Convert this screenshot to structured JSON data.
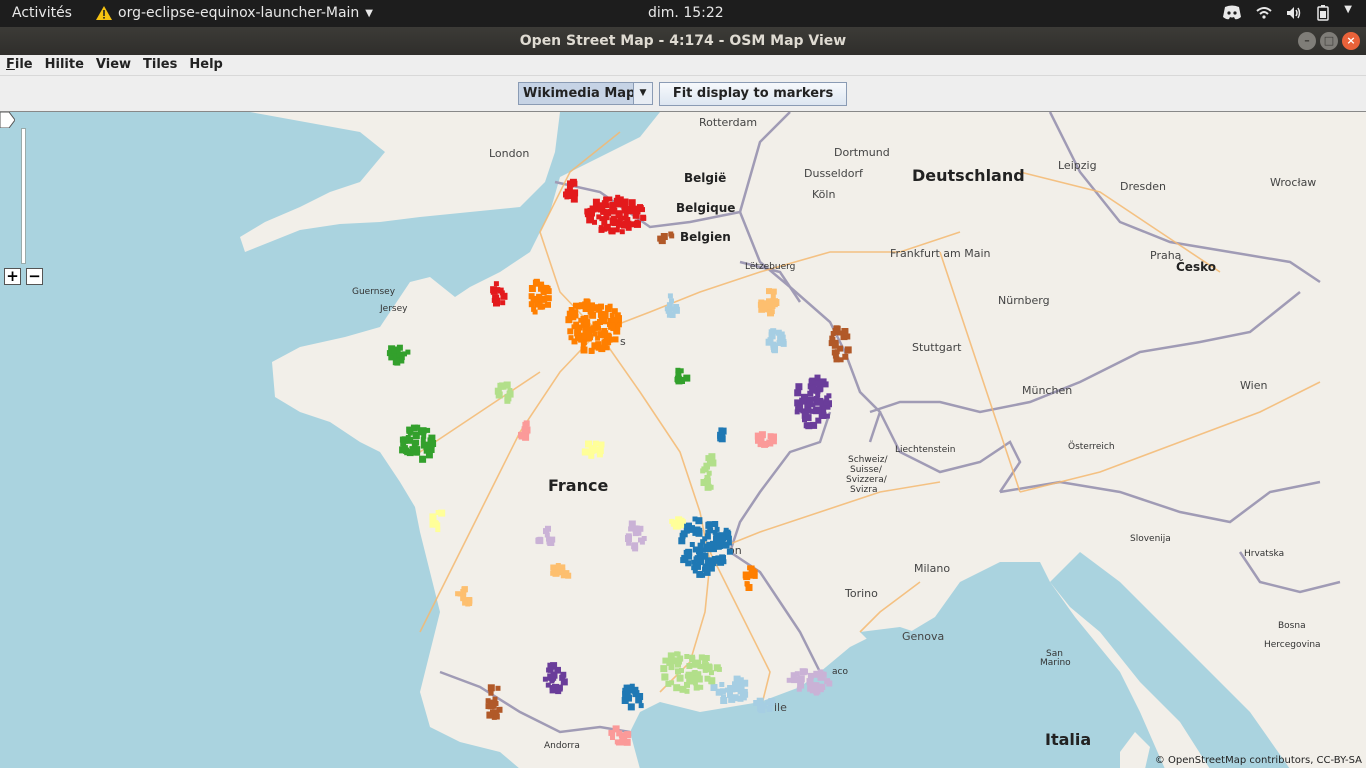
{
  "topbar": {
    "activities": "Activités",
    "app_name": "org-eclipse-equinox-launcher-Main",
    "clock": "dim. 15:22"
  },
  "window": {
    "title": "Open Street Map - 4:174 - OSM Map View"
  },
  "menubar": {
    "items": [
      {
        "label": "File",
        "mnemonic": "F"
      },
      {
        "label": "Hilite",
        "mnemonic": ""
      },
      {
        "label": "View",
        "mnemonic": ""
      },
      {
        "label": "Tiles",
        "mnemonic": ""
      },
      {
        "label": "Help",
        "mnemonic": ""
      }
    ]
  },
  "toolbar": {
    "map_source": "Wikimedia Map",
    "fit_button": "Fit display to markers"
  },
  "map": {
    "attribution": "© OpenStreetMap contributors, CC-BY-SA",
    "labels": {
      "rotterdam": "Rotterdam",
      "london": "London",
      "dortmund": "Dortmund",
      "dusseldorf": "Dusseldorf",
      "koln": "Köln",
      "deutschland": "Deutschland",
      "leipzig": "Leipzig",
      "dresden": "Dresden",
      "wroclaw": "Wrocław",
      "belgie": "België",
      "belgique": "Belgique",
      "belgien": "Belgien",
      "frankfurt": "Frankfurt am Main",
      "praha": "Praha",
      "cesko": "Česko",
      "letzebuerg": "Lëtzebuerg",
      "guernsey": "Guernsey",
      "jersey": "Jersey",
      "nurnberg": "Nürnberg",
      "stuttgart": "Stuttgart",
      "munchen": "München",
      "wien": "Wien",
      "osterreich": "Österreich",
      "liechtenstein": "Liechtenstein",
      "schweiz": "Schweiz/",
      "suisse": "Suisse/",
      "svizzera": "Svizzera/",
      "svizra": "Svizra",
      "france": "France",
      "slovenija": "Slovenija",
      "hrvatska": "Hrvatska",
      "milano": "Milano",
      "torino": "Torino",
      "genova": "Genova",
      "bosna": "Bosna",
      "hercegovina": "Hercegovina",
      "san_marino_1": "San",
      "san_marino_2": "Marino",
      "andorra": "Andorra",
      "italia": "Italia",
      "paris_fragment": "s",
      "lyon_fragment": "on",
      "monaco_fragment": "aco",
      "marseille_fragment": "lle"
    }
  },
  "colors": {
    "water": "#aad3df",
    "land": "#f2efe9",
    "marker_red": "#e31a1c",
    "marker_orange": "#ff7f00",
    "marker_light_orange": "#fdbf6f",
    "marker_green": "#33a02c",
    "marker_light_green": "#b2df8a",
    "marker_blue": "#1f78b4",
    "marker_light_blue": "#a6cee3",
    "marker_purple": "#6a3d9a",
    "marker_light_purple": "#cab2d6",
    "marker_brown": "#b15928",
    "marker_yellow": "#ffff99",
    "marker_pink": "#fb9a99"
  },
  "icons": {
    "warning": "warning-triangle-icon",
    "discord": "discord-icon",
    "wifi": "wifi-icon",
    "volume": "volume-icon",
    "battery": "battery-icon"
  }
}
